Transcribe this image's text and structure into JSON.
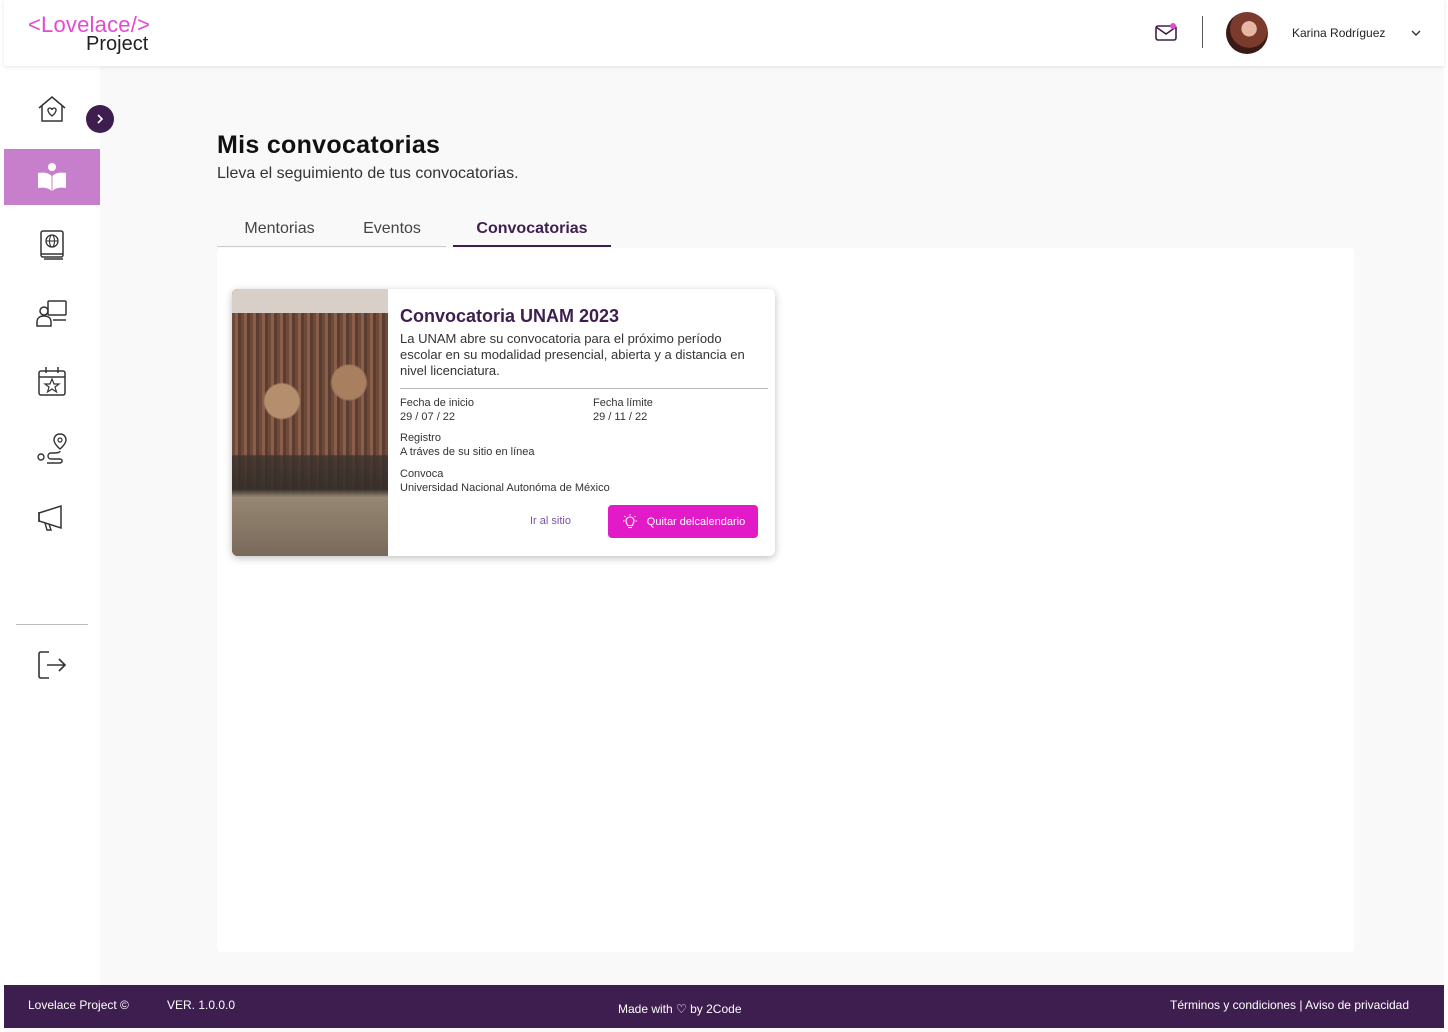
{
  "header": {
    "logo_top": "<Lovelace/>",
    "logo_bottom": "Project",
    "user_name": "Karina Rodríguez"
  },
  "sidebar": {
    "items": [
      {
        "icon": "home-heart-icon"
      },
      {
        "icon": "open-book-reader-icon"
      },
      {
        "icon": "globe-book-icon"
      },
      {
        "icon": "mentor-board-icon"
      },
      {
        "icon": "calendar-star-icon"
      },
      {
        "icon": "route-pin-icon"
      },
      {
        "icon": "megaphone-icon"
      },
      {
        "icon": "logout-icon"
      }
    ],
    "active_index": 1
  },
  "page": {
    "title": "Mis convocatorias",
    "subtitle": "Lleva el seguimiento de tus convocatorias."
  },
  "tabs": [
    {
      "label": "Mentorias",
      "active": false
    },
    {
      "label": "Eventos",
      "active": false
    },
    {
      "label": "Convocatorias",
      "active": true
    }
  ],
  "card": {
    "title": "Convocatoria UNAM 2023",
    "description": "La UNAM abre su convocatoria para el próximo período escolar en su modalidad presencial, abierta y a distancia en nivel licenciatura.",
    "start_label": "Fecha de inicio",
    "start_value": "29 / 07 / 22",
    "deadline_label": "Fecha límite",
    "deadline_value": "29 / 11 / 22",
    "registro_label": "Registro",
    "registro_value": "A tráves de su sitio en línea",
    "convoca_label": "Convoca",
    "convoca_value": "Universidad Nacional Autonóma de México",
    "link_label": "Ir al sitio",
    "button_label": "Quitar delcalendario"
  },
  "footer": {
    "copyright": "Lovelace Project ©",
    "version": "VER. 1.0.0.0",
    "made_with": "Made with ♡ by 2Code",
    "legal": "Términos y condiciones | Aviso de privacidad"
  },
  "colors": {
    "brand_purple": "#3e1e4f",
    "brand_pink": "#e24bd0",
    "active_nav": "#c77ecb",
    "button": "#e21ac8"
  }
}
